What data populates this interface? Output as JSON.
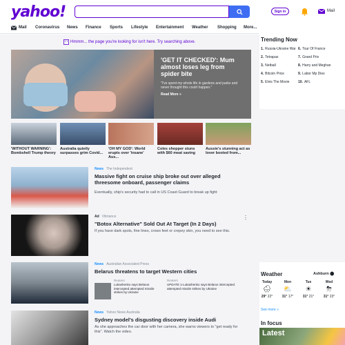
{
  "header": {
    "logo": "yahoo!",
    "signin": "Sign in",
    "mail": "Mail"
  },
  "nav": [
    {
      "label": "Mail"
    },
    {
      "label": "Coronavirus"
    },
    {
      "label": "News"
    },
    {
      "label": "Finance"
    },
    {
      "label": "Sports"
    },
    {
      "label": "Lifestyle"
    },
    {
      "label": "Entertainment"
    },
    {
      "label": "Weather"
    },
    {
      "label": "Shopping"
    },
    {
      "label": "More..."
    }
  ],
  "notfound": "Hmmm... the page you're looking for isn't here. Try searching above.",
  "hero": {
    "title": "'GET IT CHECKED': Mum almost loses leg from spider bite",
    "quote": "\"I've spent my whole life in gardens and parks and never thought this could happen.\"",
    "more": "Read More »"
  },
  "thumbs": [
    {
      "caption": "'WITHOUT WARNING': Bombshell Trump theory"
    },
    {
      "caption": "Australia quietly surpasses grim Covid..."
    },
    {
      "caption": "'OH MY GOD': World erupts over 'insane' Aus..."
    },
    {
      "caption": "Coles shopper stuns with $60 meat saving"
    },
    {
      "caption": "Aussie's stunning act as lover booted from..."
    }
  ],
  "articles": [
    {
      "source": "News",
      "publisher": "The Independent",
      "title": "Massive fight on cruise ship broke out over alleged threesome onboard, passenger claims",
      "desc": "Eventually, ship's security had to call in US Coast Guard to break up fight"
    },
    {
      "source": "Ad",
      "publisher": "Vibriance",
      "title": "\"Botox Alternative\" Sold Out At Target (In 2 Days)",
      "desc": "If you have dark spots, fine lines, crows feet or crepey skin, you need to see this."
    },
    {
      "source": "News",
      "publisher": "Australian Associated Press",
      "title": "Belarus threatens to target Western cities",
      "subs": [
        {
          "label": "Reuters",
          "text": "Lukashenko says Belarus intercepted attempted missile strikes by Ukraine"
        },
        {
          "label": "Reuters",
          "text": "UPDATE 1-Lukashenko says Belarus intercepted attempted missile strikes by Ukraine"
        }
      ]
    },
    {
      "source": "News",
      "publisher": "Yahoo News Australia",
      "title": "Sydney model's disgusting discovery inside Audi",
      "desc": "As she approaches the car door with her camera, she warns viewers to \"get ready for this\". Watch the video."
    }
  ],
  "trending": {
    "title": "Trending Now",
    "items": [
      {
        "n": "1.",
        "label": "Russia-Ukraine War"
      },
      {
        "n": "2.",
        "label": "Tetrapas"
      },
      {
        "n": "3.",
        "label": "Netball"
      },
      {
        "n": "4.",
        "label": "Bitcoin Price"
      },
      {
        "n": "5.",
        "label": "Elvis The Movie"
      },
      {
        "n": "6.",
        "label": "Tour Of France"
      },
      {
        "n": "7.",
        "label": "Grand Prix"
      },
      {
        "n": "8.",
        "label": "Harry and Meghan"
      },
      {
        "n": "9.",
        "label": "Labor Mp Dies"
      },
      {
        "n": "10.",
        "label": "AFL"
      }
    ]
  },
  "weather": {
    "title": "Weather",
    "location": "Ashburn",
    "days": [
      {
        "day": "Today",
        "icon": "🌧",
        "hi": "29°",
        "lo": "22°"
      },
      {
        "day": "Mon",
        "icon": "⛅",
        "hi": "31°",
        "lo": "17°"
      },
      {
        "day": "Tue",
        "icon": "☀",
        "hi": "31°",
        "lo": "21°"
      },
      {
        "day": "Wed",
        "icon": "⛈",
        "hi": "31°",
        "lo": "23°"
      }
    ],
    "see_more": "See more »"
  },
  "focus": {
    "title": "In focus",
    "badge": "Latest"
  }
}
